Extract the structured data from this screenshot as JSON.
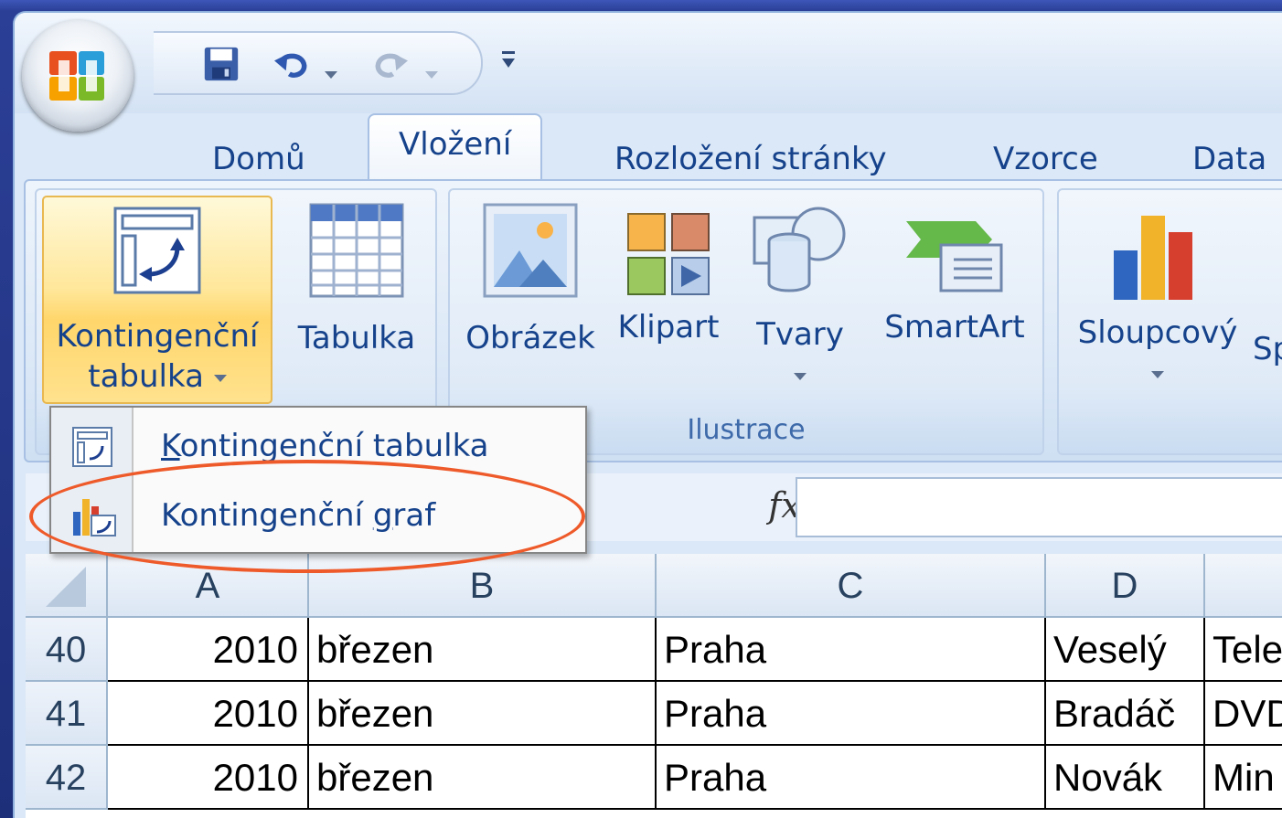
{
  "tabs": [
    {
      "label": "Domů"
    },
    {
      "label": "Vložení"
    },
    {
      "label": "Rozložení stránky"
    },
    {
      "label": "Vzorce"
    },
    {
      "label": "Data"
    }
  ],
  "ribbon": {
    "pivot_button": {
      "line1": "Kontingenční",
      "line2": "tabulka"
    },
    "table_button": "Tabulka",
    "picture_button": "Obrázek",
    "clipart_button": "Klipart",
    "shapes_button": "Tvary",
    "smartart_button": "SmartArt",
    "column_button": "Sloupcový",
    "next_button_partial": "Sp",
    "illustrations_group_label": "Ilustrace"
  },
  "dropdown": {
    "items": [
      {
        "prefix": "",
        "underline": "K",
        "suffix": "ontingenční tabulka"
      },
      {
        "prefix": "Kontingenční ",
        "underline": "g",
        "suffix": "raf"
      }
    ]
  },
  "formula_bar": {
    "fx": "fx"
  },
  "sheet": {
    "columns": [
      "A",
      "B",
      "C",
      "D",
      ""
    ],
    "rows": [
      {
        "num": "40",
        "A": "2010",
        "B": "březen",
        "C": "Praha",
        "D": "Veselý",
        "E": "Tele"
      },
      {
        "num": "41",
        "A": "2010",
        "B": "březen",
        "C": "Praha",
        "D": "Bradáč",
        "E": "DVD"
      },
      {
        "num": "42",
        "A": "2010",
        "B": "březen",
        "C": "Praha",
        "D": "Novák",
        "E": "Min"
      }
    ]
  },
  "colors": {
    "accent": "#15428b",
    "highlight": "#ee5a2a",
    "hover": "#ffe79a"
  }
}
